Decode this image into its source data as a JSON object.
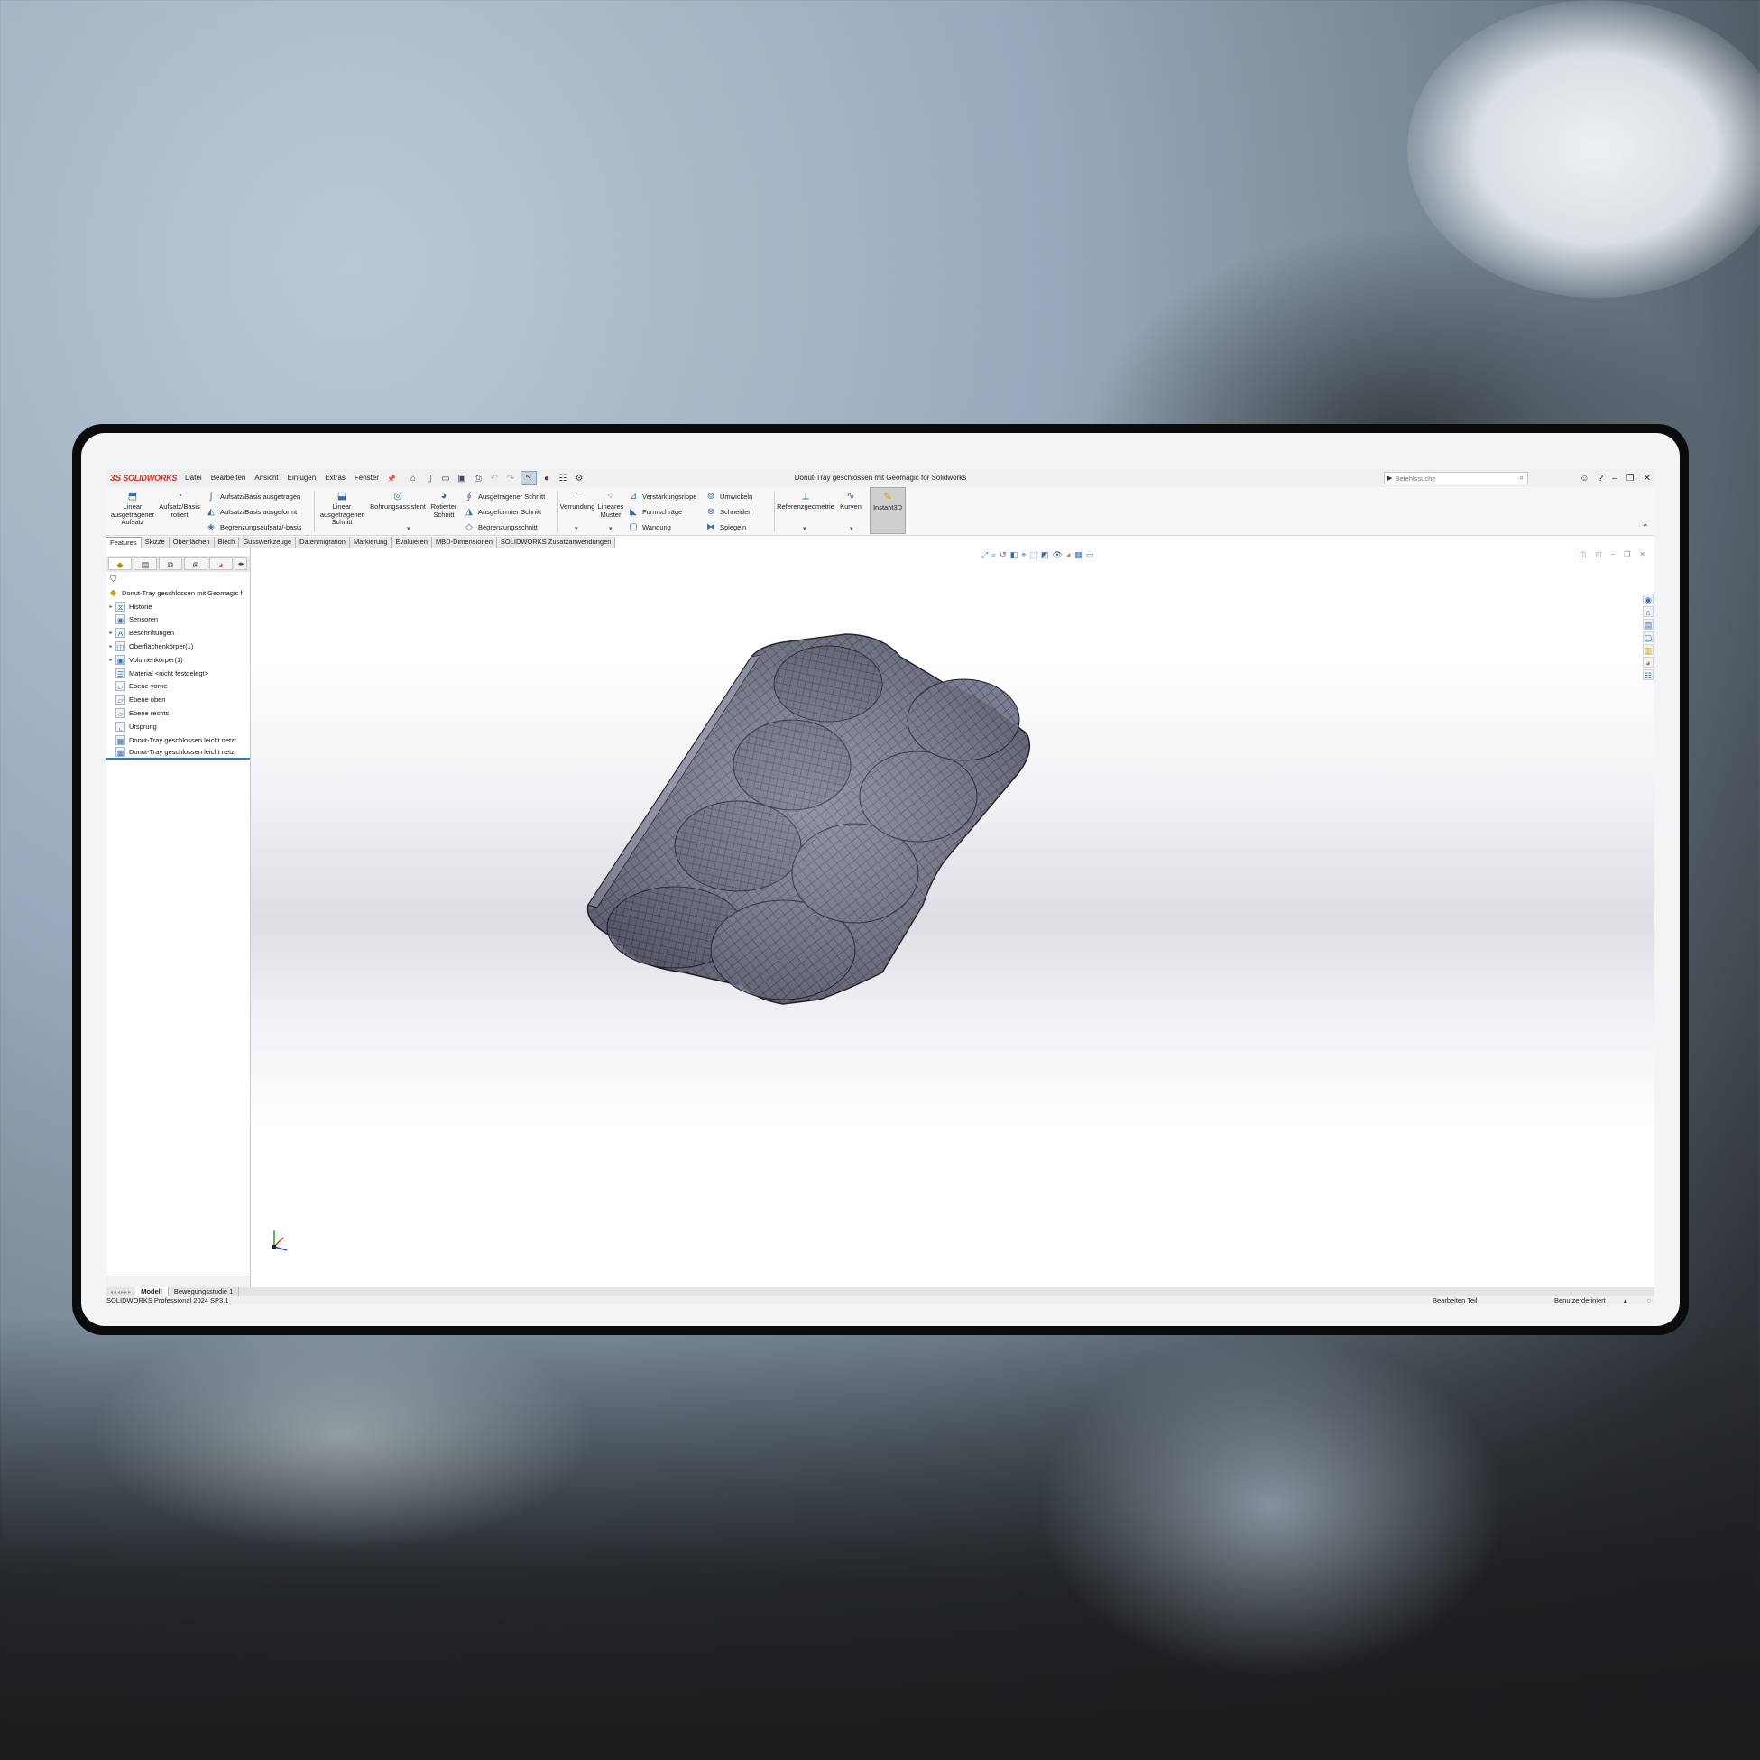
{
  "app": {
    "logo_mark": "3S",
    "logo_text": "SOLIDWORKS",
    "document_title": "Donut-Tray geschlossen mit Geomagic for Solidworks",
    "search_placeholder": "Befehlssuche"
  },
  "menu": [
    "Datei",
    "Bearbeiten",
    "Ansicht",
    "Einfügen",
    "Extras",
    "Fenster"
  ],
  "quick_access_icons": [
    "home-icon",
    "new-icon",
    "open-icon",
    "save-icon",
    "print-icon",
    "undo-icon",
    "redo-icon",
    "select-icon",
    "rebuild-icon",
    "file-properties-icon",
    "options-icon"
  ],
  "window_icons": [
    "user-icon",
    "help-icon",
    "minimize-icon",
    "restore-icon",
    "close-icon"
  ],
  "commands": {
    "extrude_boss": "Linear ausgetragener Aufsatz",
    "revolve_boss": "Aufsatz/Basis rotiert",
    "sweep_boss": "Aufsatz/Basis ausgetragen",
    "loft_boss": "Aufsatz/Basis ausgeformt",
    "boundary_boss": "Begrenzungsaufsatz/-basis",
    "extrude_cut": "Linear ausgetragener Schnitt",
    "hole_wizard": "Bohrungsassistent",
    "revolve_cut": "Rotierter Schnitt",
    "swept_cut": "Ausgetragener Schnitt",
    "lofted_cut": "Ausgeformter Schnitt",
    "boundary_cut": "Begrenzungsschnitt",
    "fillet": "Verrundung",
    "linear_pattern": "Lineares Muster",
    "rib": "Verstärkungsrippe",
    "draft": "Formschräge",
    "shell": "Wandung",
    "wrap": "Umwickeln",
    "intersect": "Schneiden",
    "mirror": "Spiegeln",
    "reference_geometry": "Referenzgeometrie",
    "curves": "Kurven",
    "instant3d": "Instant3D"
  },
  "tabs": [
    "Features",
    "Skizze",
    "Oberflächen",
    "Blech",
    "Gusswerkzeuge",
    "Datenmigration",
    "Markierung",
    "Evaluieren",
    "MBD-Dimensionen",
    "SOLIDWORKS Zusatzanwendungen"
  ],
  "active_tab": "Features",
  "feature_tree": [
    {
      "label": "Donut-Tray geschlossen mit Geomagic f",
      "icon": "part-icon",
      "expandable": false,
      "root": true
    },
    {
      "label": "Historie",
      "icon": "history-icon",
      "expandable": true
    },
    {
      "label": "Sensoren",
      "icon": "sensor-icon",
      "expandable": false
    },
    {
      "label": "Beschriftungen",
      "icon": "annotation-icon",
      "expandable": true
    },
    {
      "label": "Oberflächenkörper(1)",
      "icon": "surface-body-icon",
      "expandable": true
    },
    {
      "label": "Volumenkörper(1)",
      "icon": "solid-body-icon",
      "expandable": true
    },
    {
      "label": "Material <nicht festgelegt>",
      "icon": "material-icon",
      "expandable": false
    },
    {
      "label": "Ebene vorne",
      "icon": "plane-icon",
      "expandable": false
    },
    {
      "label": "Ebene oben",
      "icon": "plane-icon",
      "expandable": false
    },
    {
      "label": "Ebene rechts",
      "icon": "plane-icon",
      "expandable": false
    },
    {
      "label": "Ursprung",
      "icon": "origin-icon",
      "expandable": false
    },
    {
      "label": "Donut-Tray geschlossen leicht netzr",
      "icon": "mesh-icon",
      "expandable": false
    },
    {
      "label": "Donut-Tray geschlossen leicht netzr",
      "icon": "mesh-body-icon",
      "expandable": false,
      "selected": true
    }
  ],
  "bottom_tabs": [
    "Modell",
    "Bewegungsstudie 1"
  ],
  "active_bottom_tab": "Modell",
  "status": {
    "version": "SOLIDWORKS Professional 2024 SP3.1",
    "mode": "Bearbeiten Teil",
    "units": "Benutzerdefiniert"
  },
  "colors": {
    "brand": "#d52b1e",
    "accent": "#2f79c9",
    "mesh": "#6f7184"
  }
}
